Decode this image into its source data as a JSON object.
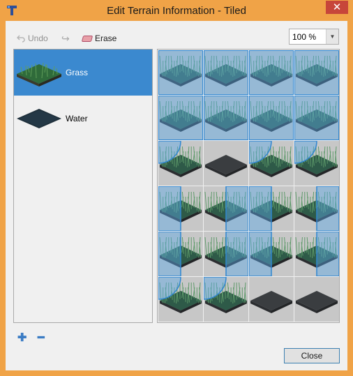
{
  "window": {
    "title": "Edit Terrain Information - Tiled",
    "close_glyph": "✕"
  },
  "toolbar": {
    "undo_label": "Undo",
    "redo_glyph": "↪",
    "erase_label": "Erase",
    "zoom_value": "100 %"
  },
  "terrains": [
    {
      "name": "Grass",
      "selected": true,
      "icon": "grass-icon"
    },
    {
      "name": "Water",
      "selected": false,
      "icon": "water-icon"
    }
  ],
  "footer": {
    "add_glyph": "✚",
    "remove_glyph": "━",
    "close_label": "Close"
  },
  "colors": {
    "accent": "#3b89cf",
    "titlebar": "#f0a347",
    "highlight": "#5aa8e6"
  }
}
